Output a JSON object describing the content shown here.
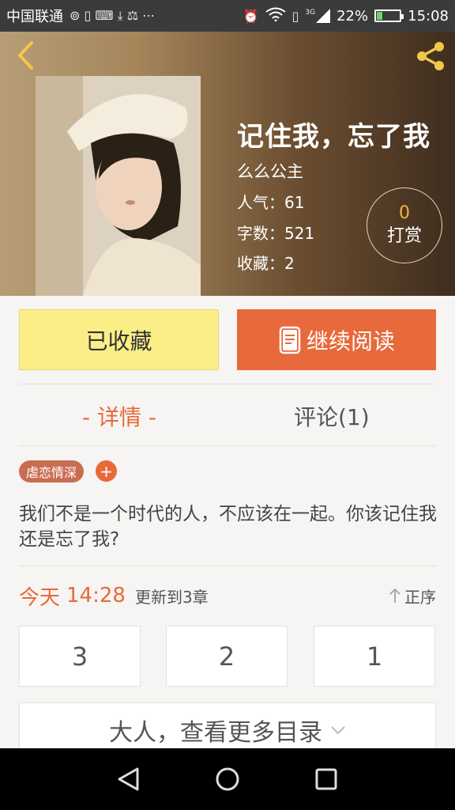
{
  "status_bar": {
    "carrier": "中国联通",
    "network": "3G",
    "battery": "22%",
    "battery_level": 0.22,
    "time": "15:08"
  },
  "book": {
    "title": "记住我，忘了我",
    "author": "么么公主",
    "popularity": "人气：61",
    "word_count": "字数：521",
    "favorites": "收藏：2",
    "reward_count": "0",
    "reward_label": "打赏"
  },
  "actions": {
    "favorite_label": "已收藏",
    "read_label": "继续阅读"
  },
  "tabs": [
    {
      "label": "- 详情 -"
    },
    {
      "label": "评论(1)"
    }
  ],
  "tags": [
    {
      "label": "虐恋情深"
    }
  ],
  "tag_add_label": "+",
  "description": "我们不是一个时代的人，不应该在一起。你该记住我还是忘了我?",
  "update": {
    "day": "今天",
    "time": "14:28",
    "text": "更新到3章",
    "order_label": "正序"
  },
  "chapters": [
    "3",
    "2",
    "1"
  ],
  "more_catalog": "大人，查看更多目录",
  "colors": {
    "accent": "#e8693b",
    "favorite_bg": "#fbee87",
    "reward_gold": "#f1b341",
    "tag_bg": "#c96d52"
  }
}
